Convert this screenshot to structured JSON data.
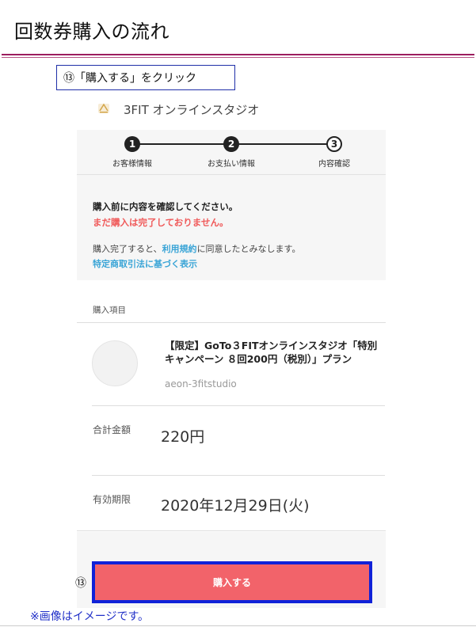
{
  "slide": {
    "title": "回数券購入の流れ",
    "callout": "⑬「購入する」をクリック",
    "step_marker": "⑬",
    "footnote": "※画像はイメージです。",
    "colors": {
      "title_rule": "#9c1e5f",
      "callout_border": "#1f2fa8",
      "highlight_border": "#1022d8"
    }
  },
  "app": {
    "logo_icon": "3fit-logo-icon",
    "name": "3FIT オンラインスタジオ"
  },
  "stepper": {
    "steps": [
      {
        "number": "1",
        "label": "お客様情報",
        "state": "done"
      },
      {
        "number": "2",
        "label": "お支払い情報",
        "state": "done"
      },
      {
        "number": "3",
        "label": "内容確認",
        "state": "current"
      }
    ]
  },
  "confirm": {
    "title": "購入前に内容を確認してください。",
    "warning": "まだ購入は完了しておりません。",
    "agree_prefix": "購入完了すると、",
    "terms_link": "利用規約",
    "agree_suffix": "に同意したとみなします。",
    "law_link": "特定商取引法に基づく表示",
    "warning_color": "#f05a5a",
    "link_color": "#39a4d6"
  },
  "purchase": {
    "section_label": "購入項目",
    "product_name": "【限定】GoTo３FITオンラインスタジオ「特別キャンペーン ８回200円（税別）」プラン",
    "product_slug": "aeon-3fitstudio",
    "total_label": "合計金額",
    "total_value": "220円",
    "expiry_label": "有効期限",
    "expiry_value": "2020年12月29日(火)",
    "buy_button": "購入する",
    "button_color": "#f2636a"
  }
}
